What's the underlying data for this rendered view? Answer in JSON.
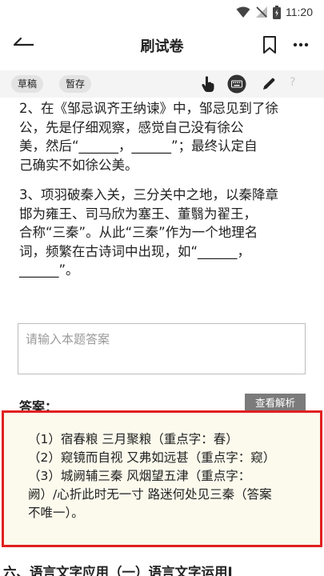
{
  "status_bar": {
    "time": "11:20"
  },
  "header": {
    "title": "刷试卷"
  },
  "toolbar": {
    "draft_label": "草稿",
    "save_label": "暂存",
    "help_label": "?"
  },
  "question_2": {
    "lines": [
      "2、在《邹忌讽齐王纳谏》中，邹忌见到了徐",
      "公，先是仔细观察，感觉自己没有徐公",
      "美，然后“______，______”；最终认定自",
      "己确实不如徐公美。"
    ]
  },
  "question_3": {
    "lines": [
      "3、项羽破秦入关，三分关中之地，以秦降章",
      "邯为雍王、司马欣为塞王、董翳为翟王，",
      "合称“三秦”。从此“三秦”作为一个地理名",
      "词，频繁在古诗词中出现，如“______，",
      "______”。"
    ]
  },
  "answer_input": {
    "placeholder": "请输入本题答案"
  },
  "answer": {
    "label": "答案：",
    "view_analysis_label": "查看解析",
    "lines": [
      "（1）宿春粮 三月聚粮（重点字：春）",
      "（2）窥镜而自视 又弗如远甚（重点字：窥）",
      "（3）城阙辅三秦 风烟望五津（重点字：",
      "阙）/心折此时无一寸 路迷何处见三秦（答案",
      "不唯一）。"
    ]
  },
  "next_section": {
    "title": "六、语言文字应用（一）语言文字运用Ⅰ"
  }
}
